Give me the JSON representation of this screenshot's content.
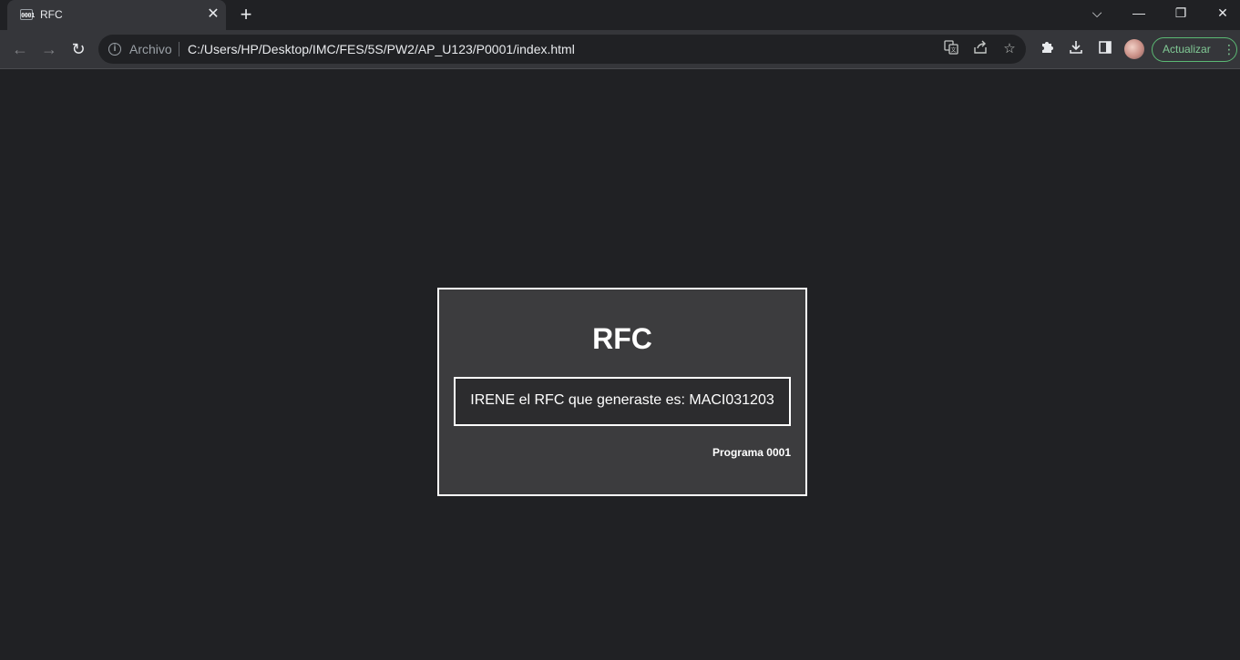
{
  "tab": {
    "title": "RFC",
    "favicon": "0001"
  },
  "window_controls": {
    "tab_search": "⌵",
    "minimize": "—",
    "restore": "❐",
    "close": "✕"
  },
  "toolbar": {
    "back": "←",
    "forward": "→",
    "reload": "↻",
    "scheme_label": "Archivo",
    "url": "C:/Users/HP/Desktop/IMC/FES/5S/PW2/AP_U123/P0001/index.html",
    "update_label": "Actualizar"
  },
  "icons": {
    "translate": "translate-icon",
    "share": "share-icon",
    "bookmark": "star-icon",
    "extensions": "puzzle-icon",
    "downloads": "download-icon",
    "side_panel": "side-panel-icon"
  },
  "colors": {
    "accent_green": "#5bb974",
    "page_bg": "#202124",
    "card_bg": "#3c3c3e"
  },
  "page": {
    "title": "RFC",
    "result": "IRENE el RFC que generaste es: MACI031203",
    "program": "Programa 0001"
  }
}
